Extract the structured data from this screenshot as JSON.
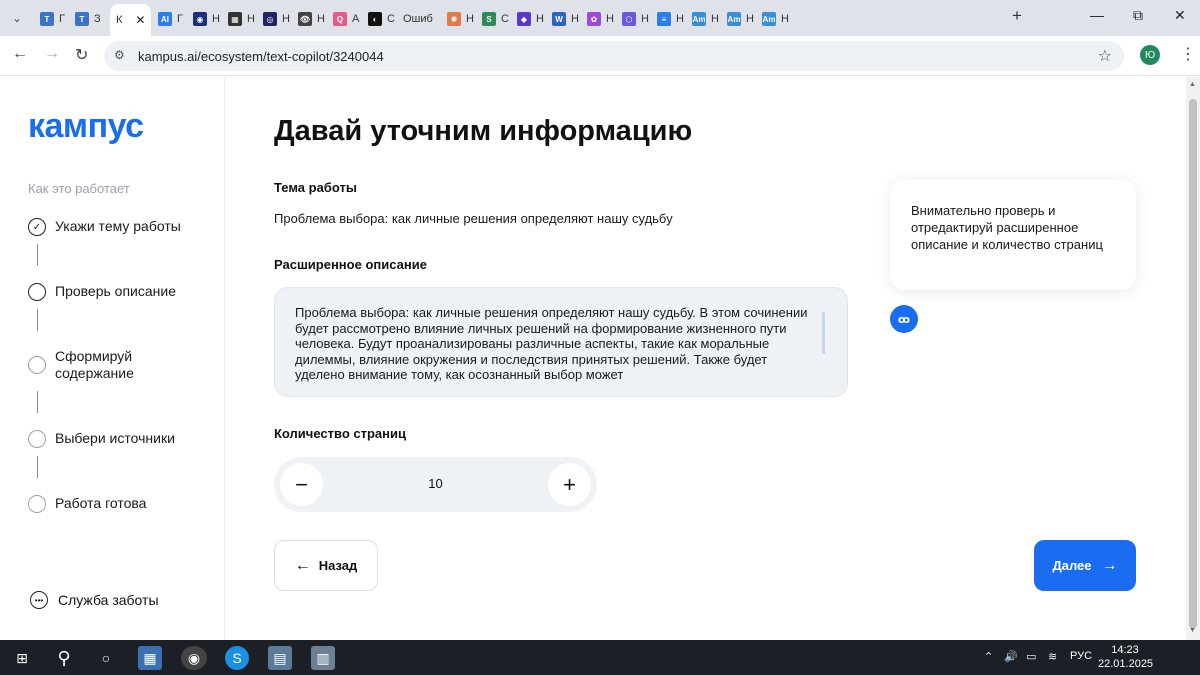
{
  "browser": {
    "tabs": [
      {
        "label": "Г",
        "icon": "T",
        "color": "#3b73c8"
      },
      {
        "label": "З",
        "icon": "T",
        "color": "#3b73c8"
      },
      {
        "label": "К",
        "icon": "",
        "color": "#ffffff",
        "active": true
      },
      {
        "label": "Г",
        "icon": "AI",
        "color": "#2b7de9"
      },
      {
        "label": "Н",
        "icon": "◉",
        "color": "#1d2e7a"
      },
      {
        "label": "Н",
        "icon": "▦",
        "color": "#333333"
      },
      {
        "label": "Н",
        "icon": "◎",
        "color": "#222266"
      },
      {
        "label": "Н",
        "icon": "👁",
        "color": "#444444"
      },
      {
        "label": "А",
        "icon": "Q",
        "color": "#e55a8a"
      },
      {
        "label": "С",
        "icon": "◐",
        "color": "#111111"
      },
      {
        "label": "Ошиб",
        "icon": "",
        "color": "#dfe3e9"
      },
      {
        "label": "Н",
        "icon": "✺",
        "color": "#e07a4a"
      },
      {
        "label": "С",
        "icon": "S",
        "color": "#2e8b57"
      },
      {
        "label": "Н",
        "icon": "◆",
        "color": "#5a3bc8"
      },
      {
        "label": "Н",
        "icon": "W",
        "color": "#2b64c8"
      },
      {
        "label": "Н",
        "icon": "✿",
        "color": "#9b4bd8"
      },
      {
        "label": "Н",
        "icon": "⬡",
        "color": "#6a5ad8"
      },
      {
        "label": "Н",
        "icon": "≡",
        "color": "#2b7de9"
      },
      {
        "label": "Н",
        "icon": "Am",
        "color": "#3a8ed8"
      },
      {
        "label": "Н",
        "icon": "Am",
        "color": "#3a8ed8"
      },
      {
        "label": "Н",
        "icon": "Am",
        "color": "#3a8ed8"
      }
    ],
    "url": "kampus.ai/ecosystem/text-copilot/3240044",
    "profile_initial": "Ю"
  },
  "sidebar": {
    "logo": "кампус",
    "how_it_works": "Как это работает",
    "steps": [
      {
        "label": "Укажи тему работы",
        "state": "done"
      },
      {
        "label": "Проверь описание",
        "state": "current"
      },
      {
        "label": "Сформируй содержание",
        "state": "pending"
      },
      {
        "label": "Выбери источники",
        "state": "pending"
      },
      {
        "label": "Работа готова",
        "state": "pending"
      }
    ],
    "support": "Служба заботы"
  },
  "main": {
    "title": "Давай уточним информацию",
    "topic_label": "Тема работы",
    "topic_value": "Проблема выбора: как личные решения определяют нашу судьбу",
    "desc_label": "Расширенное описание",
    "desc_value": "Проблема выбора: как личные решения определяют нашу судьбу. В этом сочинении будет рассмотрено влияние личных решений на формирование жизненного пути человека. Будут проанализированы различные аспекты, такие как моральные дилеммы, влияние окружения и последствия принятых решений. Также будет уделено внимание тому, как осознанный выбор может",
    "pages_label": "Количество страниц",
    "pages_value": "10",
    "back_label": "Назад",
    "next_label": "Далее"
  },
  "hint": {
    "text": "Внимательно проверь и отредактируй расширенное описание и количество страниц"
  },
  "taskbar": {
    "lang": "РУС",
    "time": "14:23",
    "date": "22.01.2025"
  },
  "colors": {
    "accent": "#1a6df0",
    "field_bg": "#eef2f7"
  }
}
